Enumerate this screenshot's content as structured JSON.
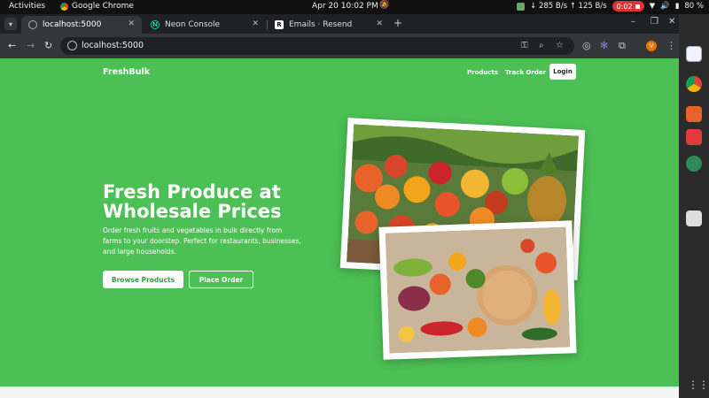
{
  "os": {
    "activities": "Activities",
    "app_name": "Google Chrome",
    "clock": "Apr 20  10:02 PM",
    "net": "↓ 285 B/s ↑ 125 B/s",
    "recording": "0:02",
    "battery": "80 %"
  },
  "browser": {
    "tabs": [
      {
        "title": "localhost:5000",
        "favicon": "globe-icon",
        "active": true
      },
      {
        "title": "Neon Console",
        "favicon": "neon-icon",
        "active": false
      },
      {
        "title": "Emails · Resend",
        "favicon": "resend-icon",
        "active": false
      }
    ],
    "url": "localhost:5000",
    "profile_initial": "V"
  },
  "site": {
    "brand": "FreshBulk",
    "nav": {
      "products": "Products",
      "track_order": "Track Order",
      "login": "Login"
    },
    "hero": {
      "title": "Fresh Produce at Wholesale Prices",
      "text": "Order fresh fruits and vegetables in bulk directly from farms to your doorstep. Perfect for restaurants, businesses, and large households.",
      "cta_primary": "Browse Products",
      "cta_secondary": "Place Order"
    }
  },
  "colors": {
    "page_bg": "#4cc054",
    "primary_text_on_white": "#3a9a43"
  }
}
